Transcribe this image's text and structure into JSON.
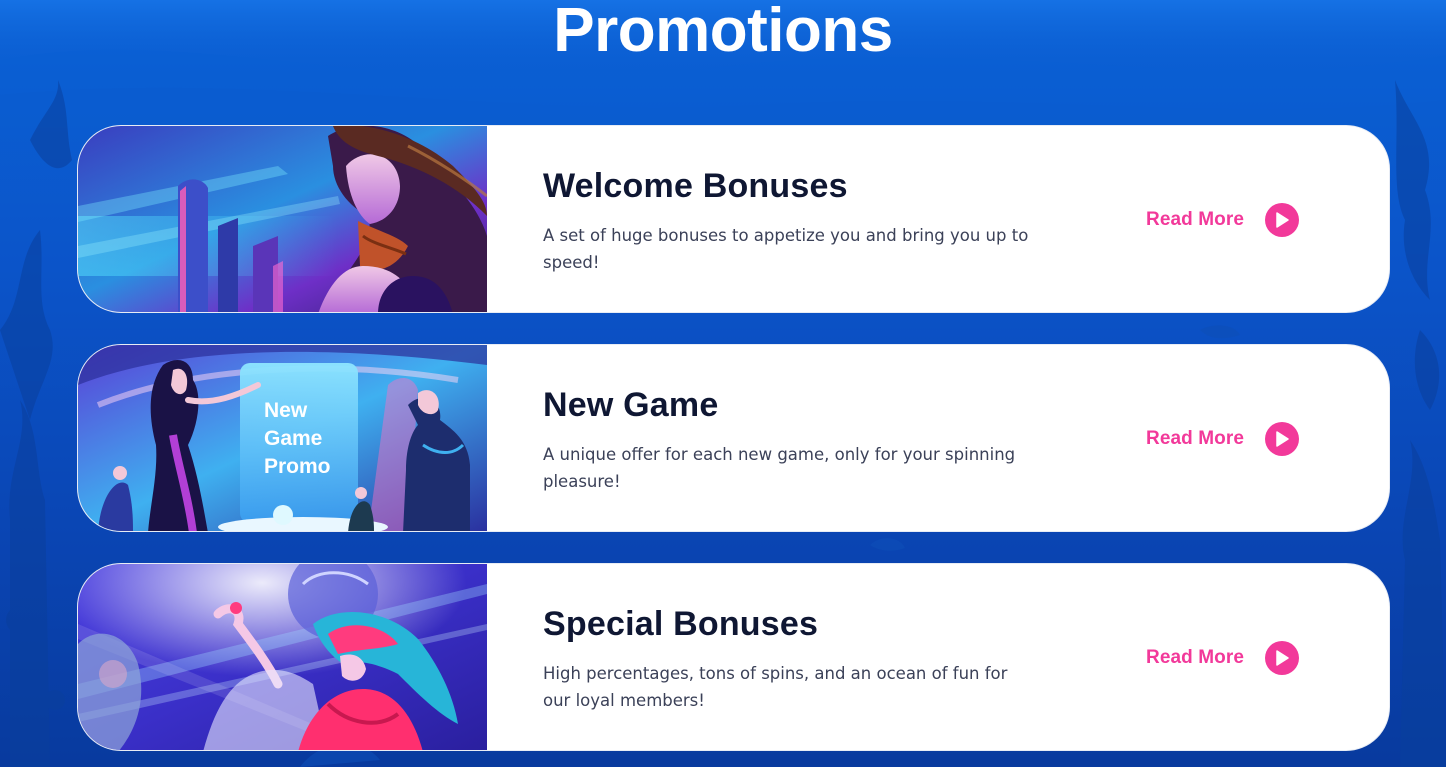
{
  "page": {
    "title": "Promotions"
  },
  "colors": {
    "background_top": "#0a62d6",
    "background_bottom": "#083a9e",
    "card_background": "#ffffff",
    "title_text": "#0f1733",
    "body_text": "#3b4158",
    "accent_pink": "#f2399a"
  },
  "promotions": [
    {
      "title": "Welcome Bonuses",
      "description": "A set of huge bonuses to appetize you and bring you up to speed!",
      "cta_label": "Read More",
      "cta_icon": "play-circle-icon",
      "image": "woman-with-flowing-hair-city-illustration"
    },
    {
      "title": "New Game",
      "description": "A unique offer for each new game, only for your spinning pleasure!",
      "cta_label": "Read More",
      "cta_icon": "play-circle-icon",
      "image": "new-game-promo-casino-illustration",
      "image_text": [
        "New",
        "Game",
        "Promo"
      ]
    },
    {
      "title": "Special Bonuses",
      "description": "High percentages, tons of spins, and an ocean of fun for our loyal members!",
      "cta_label": "Read More",
      "cta_icon": "play-circle-icon",
      "image": "woman-in-red-with-cards-illustration"
    }
  ]
}
